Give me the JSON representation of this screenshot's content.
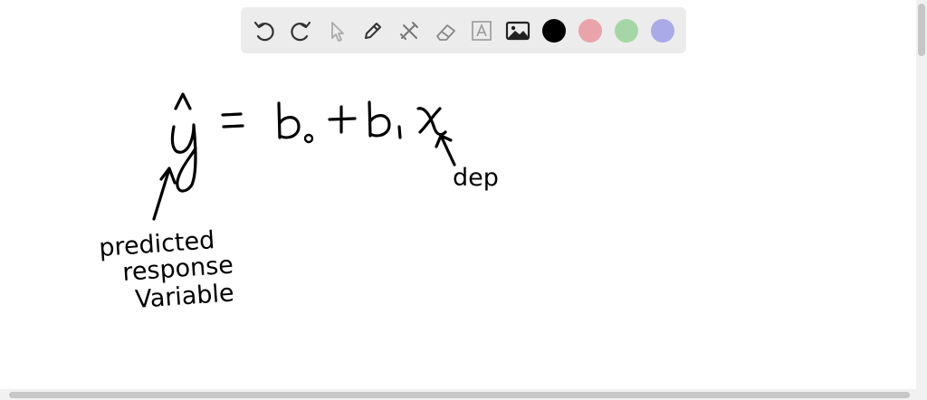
{
  "toolbar": {
    "tools": [
      {
        "icon": "undo-icon"
      },
      {
        "icon": "redo-icon"
      },
      {
        "icon": "select-pointer-icon"
      },
      {
        "icon": "pen-icon"
      },
      {
        "icon": "tools-icon"
      },
      {
        "icon": "eraser-icon"
      },
      {
        "icon": "text-icon"
      },
      {
        "icon": "image-icon"
      }
    ],
    "colors": [
      "#000000",
      "#e8a3ab",
      "#a6d6a6",
      "#aaaae8"
    ]
  },
  "canvas": {
    "annotations": [
      {
        "name": "predicted-label",
        "text": "predicted"
      },
      {
        "name": "response-label",
        "text": "response"
      },
      {
        "name": "variable-label",
        "text": "Variable"
      },
      {
        "name": "dep-label",
        "text": "dep"
      }
    ]
  }
}
